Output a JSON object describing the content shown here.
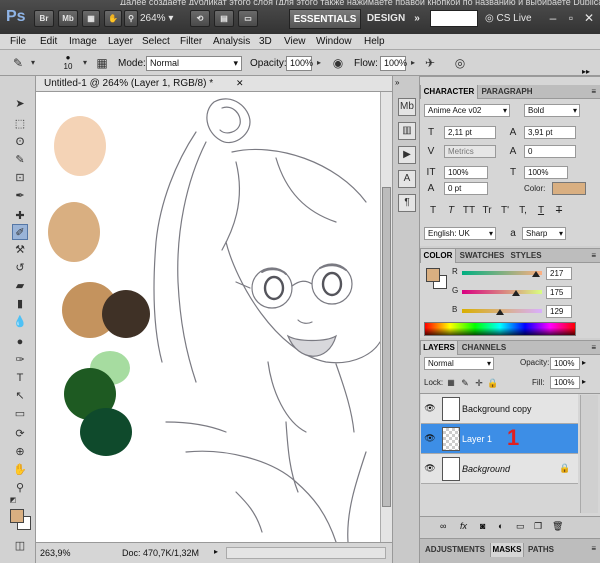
{
  "colors": {
    "accent": "#3d8ee6",
    "fg_swatch": "#d9af81",
    "annotation": "#e02020"
  },
  "top_bar": {
    "snippet": "Далее создаете дубликат этого слоя (для этого также нажимаете правой кнопкой по названию и выбираете Duplicate layer)",
    "logo": "Ps",
    "buttons": [
      "Br",
      "Mb"
    ],
    "zoom": "264%",
    "workspace_active": "ESSENTIALS",
    "workspace_other": "DESIGN",
    "more": "»",
    "cs_live": "CS Live"
  },
  "menu": [
    "File",
    "Edit",
    "Image",
    "Layer",
    "Select",
    "Filter",
    "Analysis",
    "3D",
    "View",
    "Window",
    "Help"
  ],
  "options_bar": {
    "brush_size": "10",
    "mode_label": "Mode:",
    "mode_value": "Normal",
    "opacity_label": "Opacity:",
    "opacity_value": "100%",
    "flow_label": "Flow:",
    "flow_value": "100%"
  },
  "document": {
    "title": "Untitled-1 @ 264% (Layer 1, RGB/8) *",
    "status_zoom": "263,9%",
    "status_doc": "Doc: 470,7K/1,32M"
  },
  "character": {
    "tabs": [
      "CHARACTER",
      "PARAGRAPH"
    ],
    "font_family": "Anime Ace v02",
    "font_style": "Bold",
    "font_size": "2,11 pt",
    "leading": "3,91 pt",
    "kerning": "Metrics",
    "tracking": "0",
    "vertical_scale": "100%",
    "horizontal_scale": "100%",
    "baseline": "0 pt",
    "color_label": "Color:",
    "type_buttons": [
      "T",
      "T",
      "TT",
      "Tr",
      "T'",
      "T,",
      "T",
      "T"
    ],
    "language": "English: UK",
    "aa_label": "a",
    "antialias": "Sharp"
  },
  "color_panel": {
    "tabs": [
      "COLOR",
      "SWATCHES",
      "STYLES"
    ],
    "channels": [
      {
        "label": "R",
        "value": "217"
      },
      {
        "label": "G",
        "value": "175"
      },
      {
        "label": "B",
        "value": "129"
      }
    ]
  },
  "layers_panel": {
    "tabs": [
      "LAYERS",
      "CHANNELS"
    ],
    "blend_mode": "Normal",
    "opacity_label": "Opacity:",
    "opacity_value": "100%",
    "lock_label": "Lock:",
    "fill_label": "Fill:",
    "fill_value": "100%",
    "layers": [
      {
        "name": "Background copy",
        "selected": false
      },
      {
        "name": "Layer 1",
        "selected": true
      },
      {
        "name": "Background",
        "selected": false,
        "italic": true
      }
    ],
    "annotation": "1",
    "footer_icons": [
      "link-icon",
      "fx-icon",
      "mask-icon",
      "adjustment-icon",
      "group-icon",
      "new-layer-icon",
      "trash-icon"
    ]
  },
  "bottom_tabs": [
    "ADJUSTMENTS",
    "MASKS",
    "PATHS"
  ]
}
